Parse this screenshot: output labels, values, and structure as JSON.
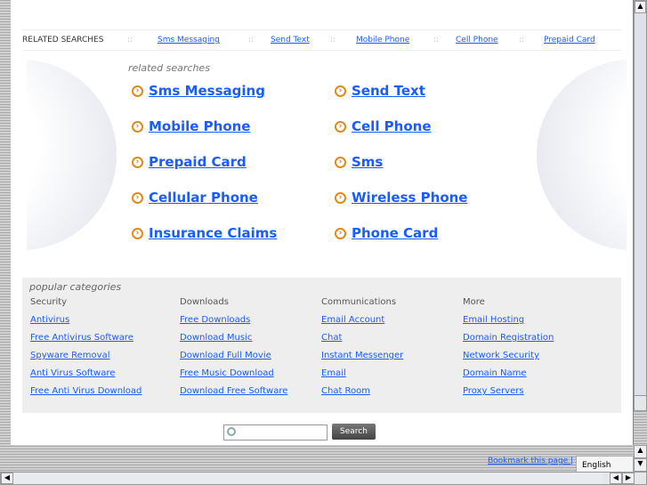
{
  "topbar": {
    "label": "RELATED SEARCHES",
    "sep": "::",
    "links": [
      "Sms Messaging",
      "Send Text",
      "Mobile Phone",
      "Cell Phone",
      "Prepaid Card"
    ]
  },
  "related": {
    "title": "related searches",
    "left": [
      "Sms Messaging",
      "Mobile Phone",
      "Prepaid Card",
      "Cellular Phone",
      "Insurance Claims"
    ],
    "right": [
      "Send Text",
      "Cell Phone",
      "Sms",
      "Wireless Phone",
      "Phone Card"
    ]
  },
  "popular": {
    "title": "popular categories",
    "columns": [
      {
        "heading": "Security",
        "links": [
          "Antivirus",
          "Free Antivirus Software",
          "Spyware Removal",
          "Anti Virus Software",
          "Free Anti Virus Download"
        ]
      },
      {
        "heading": "Downloads",
        "links": [
          "Free Downloads",
          "Download Music",
          "Download Full Movie",
          "Free Music Download",
          "Download Free Software"
        ]
      },
      {
        "heading": "Communications",
        "links": [
          "Email Account",
          "Chat",
          "Instant Messenger",
          "Email",
          "Chat Room"
        ]
      },
      {
        "heading": "More",
        "links": [
          "Email Hosting",
          "Domain Registration",
          "Network Security",
          "Domain Name",
          "Proxy Servers"
        ]
      }
    ]
  },
  "search": {
    "button": "Search",
    "value": ""
  },
  "footer": {
    "bookmark": "Bookmark this page |",
    "language": "English"
  },
  "colors": {
    "link": "#1a5cff",
    "arrow": "#e08a1a"
  }
}
